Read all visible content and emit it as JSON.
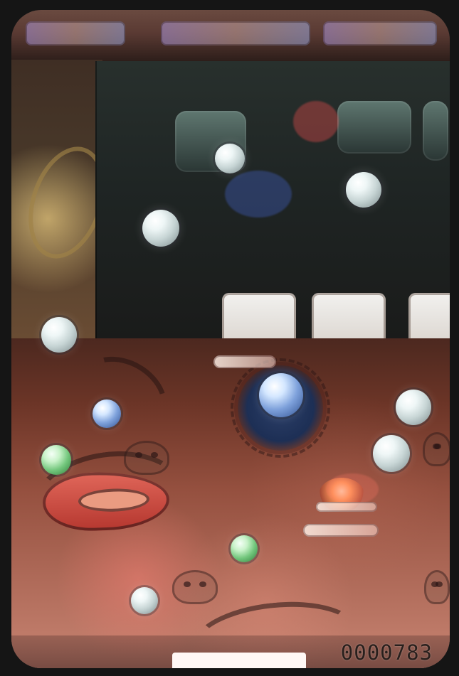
{
  "screen": {
    "score": "0000783"
  },
  "objects": {
    "balls": [
      {
        "name": "ball-upper-left"
      },
      {
        "name": "ball-upper-right"
      },
      {
        "name": "ball-upper-center"
      },
      {
        "name": "ball-left-mid"
      },
      {
        "name": "ball-center-bumper"
      },
      {
        "name": "ball-right-top"
      },
      {
        "name": "ball-right-lower"
      },
      {
        "name": "ball-left-lower"
      },
      {
        "name": "ball-center-lower"
      },
      {
        "name": "ball-bottom-left"
      },
      {
        "name": "ball-left-blue"
      }
    ]
  }
}
